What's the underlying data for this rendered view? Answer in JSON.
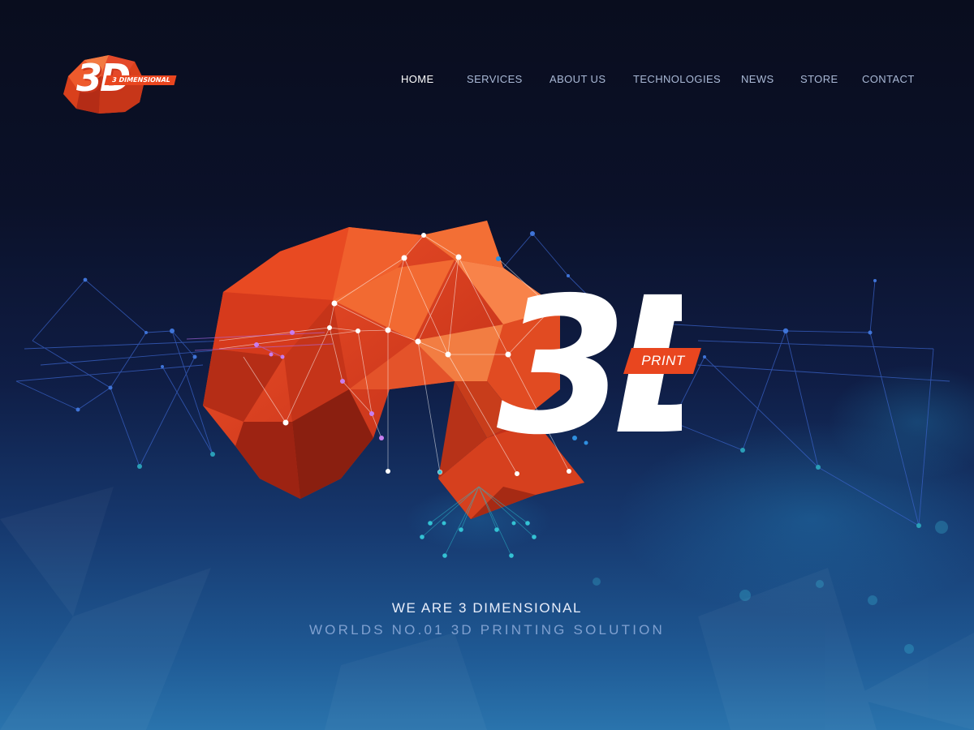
{
  "brand": {
    "logo_mark": "3D",
    "logo_tag": "3 DIMENSIONAL",
    "hero_mark": "3D",
    "hero_tag": "PRINT"
  },
  "nav": {
    "items": [
      {
        "label": "HOME",
        "active": true
      },
      {
        "label": "SERVICES",
        "active": false
      },
      {
        "label": "ABOUT US",
        "active": false
      },
      {
        "label": "TECHNOLOGIES",
        "active": false
      },
      {
        "label": "NEWS",
        "active": false
      },
      {
        "label": "STORE",
        "active": false
      },
      {
        "label": "CONTACT",
        "active": false
      }
    ]
  },
  "hero": {
    "headline": "WE ARE 3 DIMENSIONAL",
    "subheadline": "WORLDS NO.01 3D PRINTING SOLUTION"
  },
  "colors": {
    "accent": "#e9461f",
    "background_top": "#090d1e",
    "background_bottom": "#2a74ad",
    "nav_active": "#ffffff",
    "nav_inactive": "#aab9d6"
  },
  "icons": {
    "logo": "low-poly-3d-logo",
    "hero_art": "low-poly-brain-network-illustration"
  }
}
